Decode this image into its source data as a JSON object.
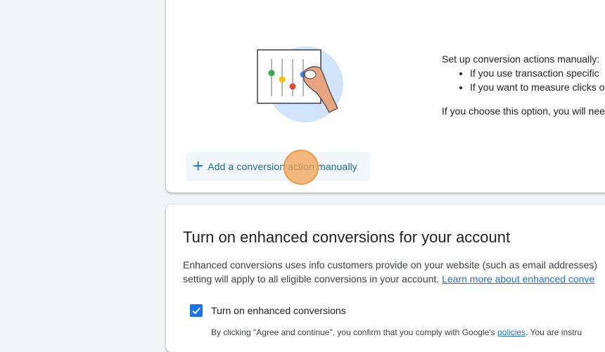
{
  "setup": {
    "intro": "Set up conversion actions manually:",
    "bullets": [
      "If you use transaction specific",
      "If you want to measure clicks o"
    ],
    "note": "If you choose this option, you will nee"
  },
  "add_button": {
    "icon": "plus-icon",
    "label": "Add a conversion action manually"
  },
  "enhanced": {
    "title": "Turn on enhanced conversions for your account",
    "desc_line1": "Enhanced conversions uses info customers provide on your website (such as email addresses)",
    "desc_line2": "setting will apply to all eligible conversions in your account.",
    "learn_more": "Learn more about enhanced conve",
    "checkbox_label": "Turn on enhanced conversions",
    "checkbox_checked": true,
    "fine_print_before": "By clicking \"Agree and continue\", you confirm that you comply with Google's",
    "fine_print_link": "policies",
    "fine_print_after": ". You are instru"
  },
  "colors": {
    "accent": "#1a73e8",
    "background": "#f1f3f4",
    "click_marker": "#f2a152"
  }
}
